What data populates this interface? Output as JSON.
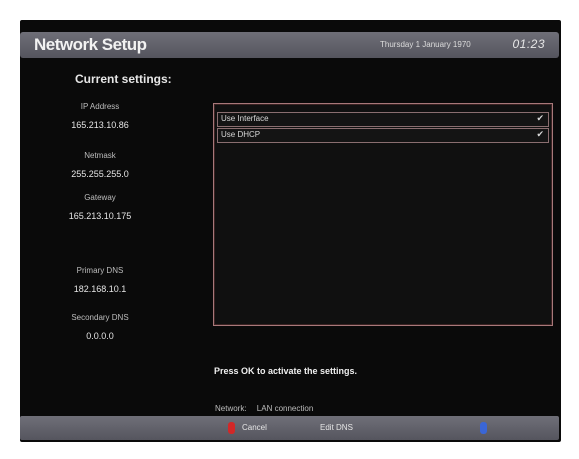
{
  "header": {
    "title": "Network Setup",
    "date": "Thursday 1 January 1970",
    "time": "01:23"
  },
  "current_settings": {
    "heading": "Current settings:",
    "fields": [
      {
        "label": "IP Address",
        "value": "165.213.10.86"
      },
      {
        "label": "Netmask",
        "value": "255.255.255.0"
      },
      {
        "label": "Gateway",
        "value": "165.213.10.175"
      },
      {
        "label": "Primary DNS",
        "value": "182.168.10.1"
      },
      {
        "label": "Secondary DNS",
        "value": "0.0.0.0"
      }
    ]
  },
  "options": [
    {
      "label": "Use Interface",
      "checked": true
    },
    {
      "label": "Use DHCP",
      "checked": true
    }
  ],
  "hint": "Press OK to activate the settings.",
  "network": {
    "label": "Network:",
    "value": "LAN connection"
  },
  "footer": {
    "cancel_label": "Cancel",
    "edit_dns_label": "Edit DNS",
    "red_color": "#d22828",
    "blue_color": "#3a66d6"
  },
  "colors": {
    "background": "#0a0a0a",
    "bar": "#5f5f68",
    "list_border": "#a8787a"
  }
}
